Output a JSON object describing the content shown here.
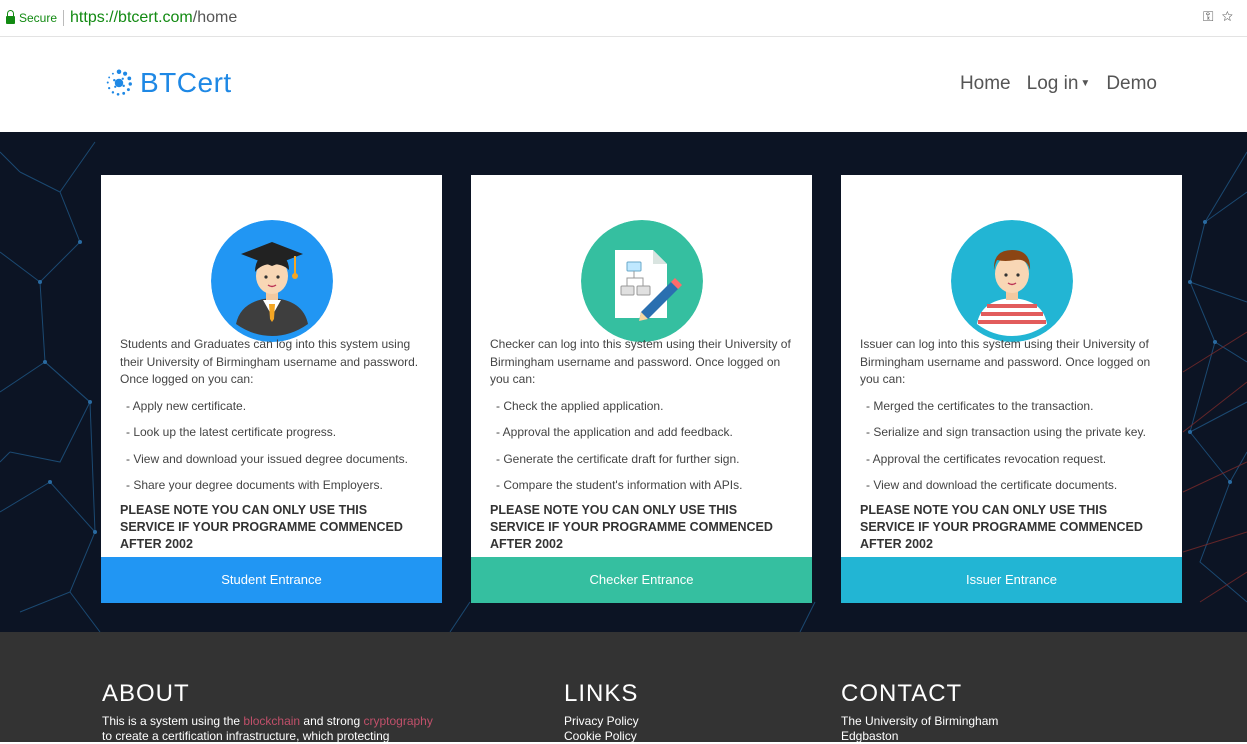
{
  "browser": {
    "secure_label": "Secure",
    "url_host": "https://btcert.com",
    "url_path": "/home",
    "icons": [
      "key-icon",
      "star-icon"
    ]
  },
  "header": {
    "logo_text": "BTCert",
    "nav": [
      {
        "label": "Home"
      },
      {
        "label": "Log in"
      },
      {
        "label": "Demo"
      }
    ]
  },
  "cards": [
    {
      "intro": "Students and Graduates can log into this system using their University of Birmingham username and password. Once logged on you can:",
      "items": [
        "- Apply new certificate.",
        "- Look up the latest certificate progress.",
        "- View and download your issued degree documents.",
        "- Share your degree documents with Employers."
      ],
      "note": "PLEASE NOTE YOU CAN ONLY USE THIS SERVICE IF YOUR PROGRAMME COMMENCED AFTER 2002",
      "button": "Student Entrance",
      "color": "#2196f3",
      "icon": "graduate-icon"
    },
    {
      "intro": "Checker can log into this system using their University of Birmingham username and password. Once logged on you can:",
      "items": [
        "- Check the applied application.",
        "- Approval the application and add feedback.",
        "- Generate the certificate draft for further sign.",
        "- Compare the student's information with APIs."
      ],
      "note": "PLEASE NOTE YOU CAN ONLY USE THIS SERVICE IF YOUR PROGRAMME COMMENCED AFTER 2002",
      "button": "Checker Entrance",
      "color": "#35bfa0",
      "icon": "document-edit-icon"
    },
    {
      "intro": "Issuer can log into this system using their University of Birmingham username and password. Once logged on you can:",
      "items": [
        "- Merged the certificates to the transaction.",
        "- Serialize and sign transaction using the private key.",
        "- Approval the certificates revocation request.",
        "- View and download the certificate documents."
      ],
      "note": "PLEASE NOTE YOU CAN ONLY USE THIS SERVICE IF YOUR PROGRAMME COMMENCED AFTER 2002",
      "button": "Issuer Entrance",
      "color": "#22b5d4",
      "icon": "person-icon"
    }
  ],
  "footer": {
    "about": {
      "title": "ABOUT",
      "line1_a": "This is a system using the ",
      "line1_b": "blockchain",
      "line1_c": " and strong ",
      "line1_d": "cryptography",
      "line2": "to create a certification infrastructure, which protecting"
    },
    "links": {
      "title": "LINKS",
      "items": [
        "Privacy Policy",
        "Cookie Policy"
      ]
    },
    "contact": {
      "title": "CONTACT",
      "items": [
        "The University of Birmingham",
        "Edgbaston"
      ]
    }
  }
}
